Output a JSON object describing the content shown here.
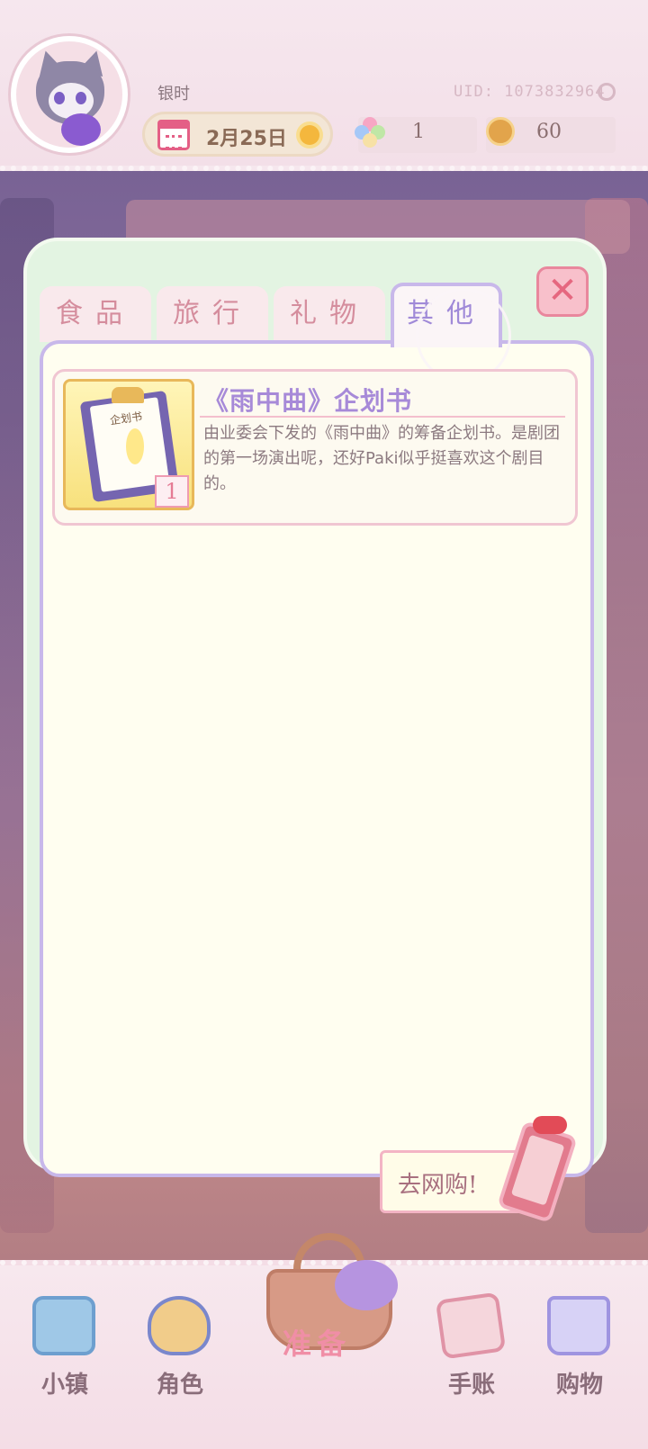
{
  "header": {
    "username": "银时",
    "uid": "UID: 1073832964",
    "date": "2月25日",
    "gems": "1",
    "coins": "60"
  },
  "tabs": [
    {
      "label": "食品"
    },
    {
      "label": "旅行"
    },
    {
      "label": "礼物"
    },
    {
      "label": "其他",
      "selected": true
    }
  ],
  "items": [
    {
      "title": "《雨中曲》企划书",
      "description": "由业委会下发的《雨中曲》的筹备企划书。是剧团的第一场演出呢，还好Paki似乎挺喜欢这个剧目的。",
      "quantity": "1",
      "thumb_label": "企划书"
    }
  ],
  "shop_button": "去网购!",
  "bottom_nav": [
    {
      "label": "小镇",
      "icon": "map-icon"
    },
    {
      "label": "角色",
      "icon": "character-icon"
    },
    {
      "label": "准备",
      "icon": "basket-icon",
      "active": true
    },
    {
      "label": "手账",
      "icon": "journal-icon"
    },
    {
      "label": "购物",
      "icon": "shopping-bag-icon"
    }
  ],
  "colors": {
    "accent_purple": "#a78ad8",
    "tab_pink": "#d58d9d",
    "panel_green": "#e3f4e2",
    "close_red": "#e5677f"
  }
}
